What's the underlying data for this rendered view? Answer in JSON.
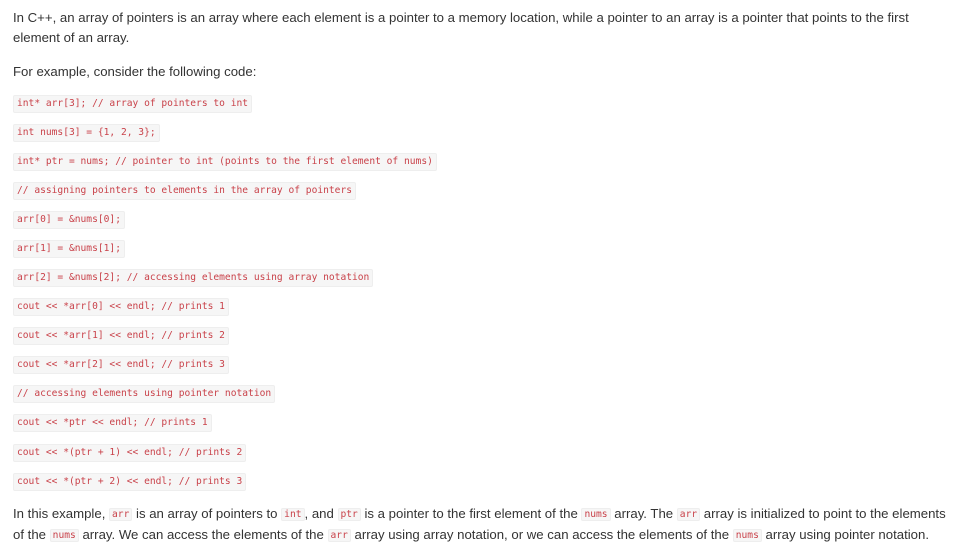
{
  "intro": "In C++, an array of pointers is an array where each element is a pointer to a memory location, while a pointer to an array is a pointer that points to the first element of an array.",
  "example_lead": "For example, consider the following code:",
  "code_lines": [
    "int* arr[3]; // array of pointers to int",
    "int nums[3] = {1, 2, 3};",
    "int* ptr = nums; // pointer to int (points to the first element of nums)",
    "// assigning pointers to elements in the array of pointers",
    "arr[0] = &nums[0];",
    "arr[1] = &nums[1];",
    "arr[2] = &nums[2]; // accessing elements using array notation",
    "cout << *arr[0] << endl; // prints 1",
    "cout << *arr[1] << endl; // prints 2",
    "cout << *arr[2] << endl; // prints 3",
    "// accessing elements using pointer notation",
    "cout << *ptr << endl; // prints 1",
    "cout << *(ptr + 1) << endl; // prints 2",
    "cout << *(ptr + 2) << endl; // prints 3"
  ],
  "summary": {
    "t1": "In this example, ",
    "c1": "arr",
    "t2": " is an array of pointers to ",
    "c2": "int",
    "t3": ", and ",
    "c3": "ptr",
    "t4": " is a pointer to the first element of the ",
    "c4": "nums",
    "t5": " array. The ",
    "c5": "arr",
    "t6": " array is initialized to point to the elements of the ",
    "c6": "nums",
    "t7": " array. We can access the elements of the ",
    "c7": "arr",
    "t8": " array using array notation, or we can access the elements of the ",
    "c8": "nums",
    "t9": " array using pointer notation."
  },
  "colors": {
    "text": "#333333",
    "code_text": "#c9424a",
    "code_bg": "#f6f6f6"
  }
}
